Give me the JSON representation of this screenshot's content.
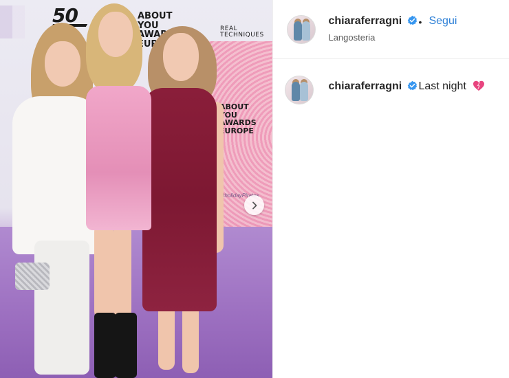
{
  "post": {
    "author": {
      "username": "chiaraferragni",
      "verified": true,
      "follow_label": "Segui",
      "separator": "•",
      "location": "Langosteria"
    },
    "caption": {
      "username": "chiaraferragni",
      "text": "Last night",
      "emoji": "heart-icon"
    },
    "media": {
      "logo_50": "50",
      "awards_text": "ABOUT YOU AWARDS EUROPE",
      "real_techniques": "REAL TECHNIQUES",
      "awards_text_2": "ABOUT YOU AWARDS EUROPE",
      "hashtag": "#holidayPirates"
    },
    "navigation": {
      "next_icon": "chevron-right-icon"
    }
  },
  "colors": {
    "link_blue": "#2c7fd6",
    "verified_blue": "#3897f0",
    "heart_pink": "#e8457f"
  }
}
